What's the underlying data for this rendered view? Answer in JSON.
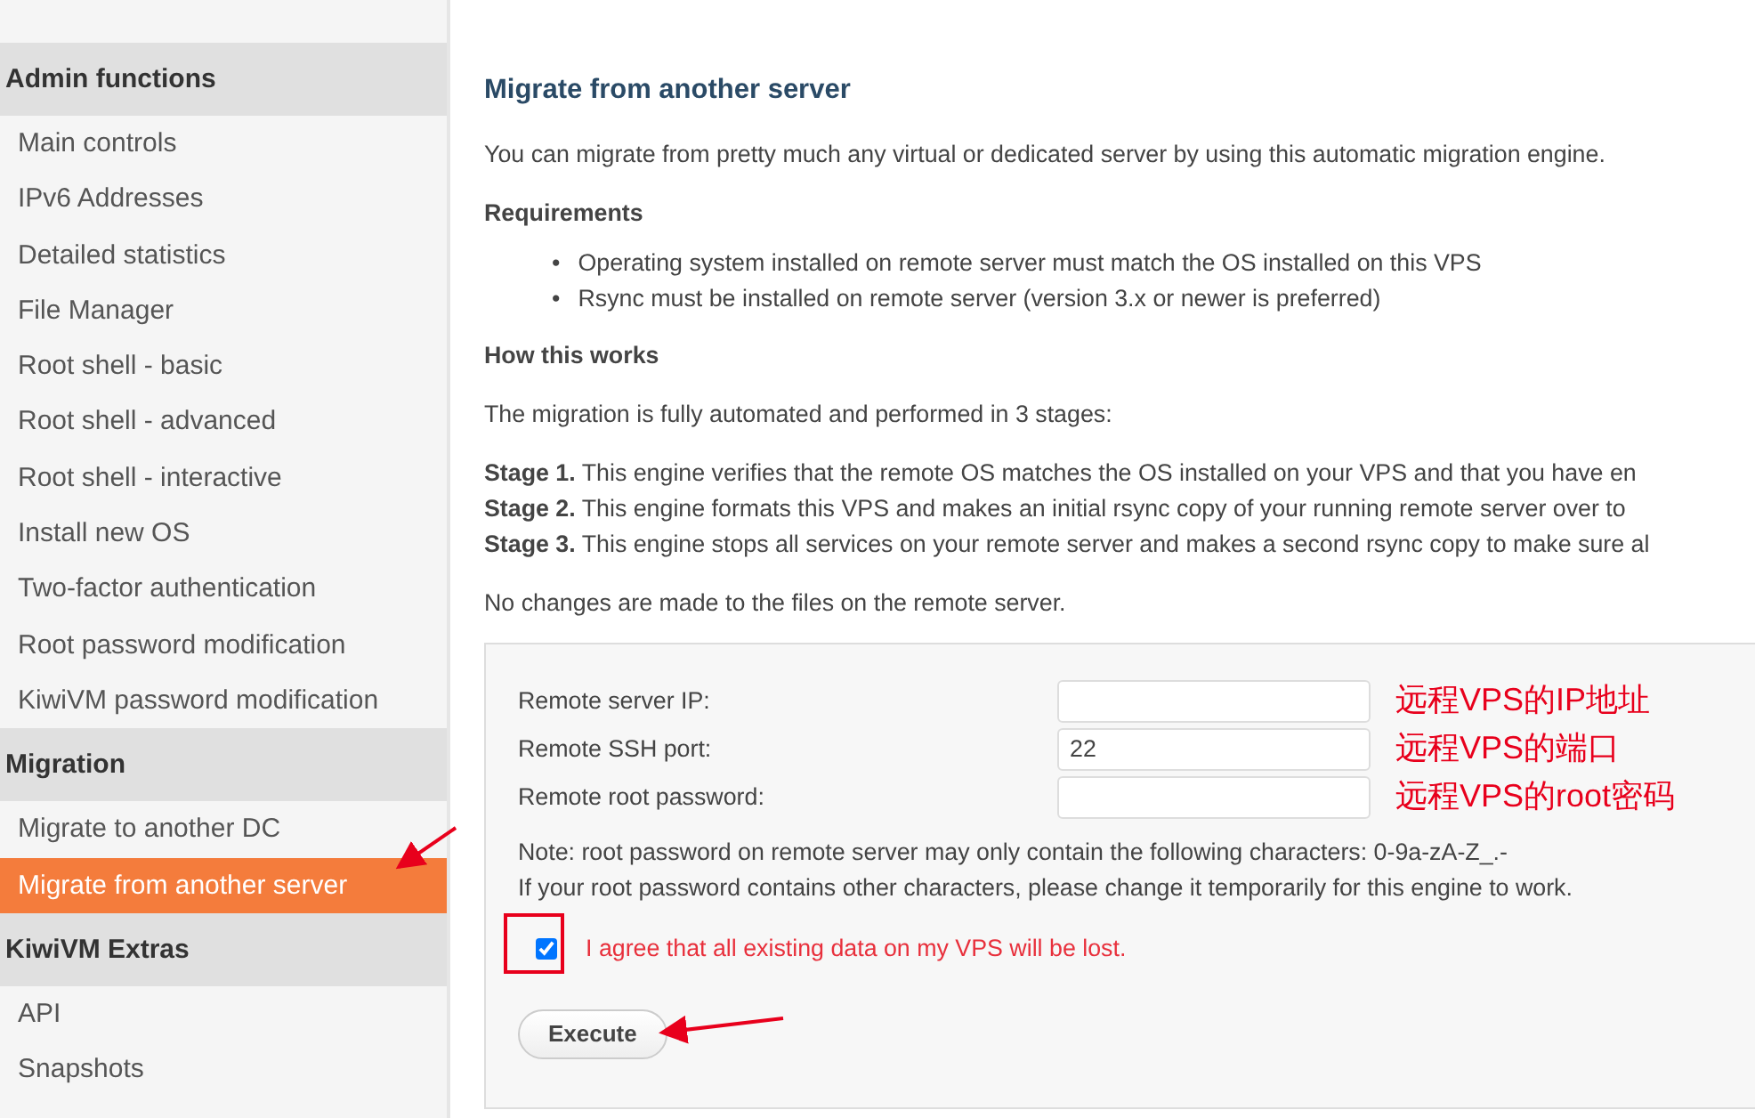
{
  "sidebar": {
    "sections": [
      {
        "title": "Admin functions",
        "items": [
          {
            "label": "Main controls",
            "selected": false
          },
          {
            "label": "IPv6 Addresses",
            "selected": false
          },
          {
            "label": "Detailed statistics",
            "selected": false
          },
          {
            "label": "File Manager",
            "selected": false
          },
          {
            "label": "Root shell - basic",
            "selected": false
          },
          {
            "label": "Root shell - advanced",
            "selected": false
          },
          {
            "label": "Root shell - interactive",
            "selected": false
          },
          {
            "label": "Install new OS",
            "selected": false
          },
          {
            "label": "Two-factor authentication",
            "selected": false
          },
          {
            "label": "Root password modification",
            "selected": false
          },
          {
            "label": "KiwiVM password modification",
            "selected": false
          }
        ]
      },
      {
        "title": "Migration",
        "items": [
          {
            "label": "Migrate to another DC",
            "selected": false
          },
          {
            "label": "Migrate from another server",
            "selected": true
          }
        ]
      },
      {
        "title": "KiwiVM Extras",
        "items": [
          {
            "label": "API",
            "selected": false
          },
          {
            "label": "Snapshots",
            "selected": false
          }
        ]
      }
    ]
  },
  "main": {
    "title": "Migrate from another server",
    "intro": "You can migrate from pretty much any virtual or dedicated server by using this automatic migration engine.",
    "requirements_title": "Requirements",
    "requirements": [
      {
        "marker": "•",
        "text": "Operating system installed on remote server must match the OS installed on this VPS"
      },
      {
        "marker": "•",
        "text": "Rsync must be installed on remote server (version 3.x or newer is preferred)"
      }
    ],
    "how_title": "How this works",
    "how_intro": "The migration is fully automated and performed in 3 stages:",
    "stages": [
      "**Stage 1.** This engine verifies that the remote OS matches the OS installed on your VPS and that you have en",
      "**Stage 2.** This engine formats this VPS and makes an initial rsync copy of your running remote server over to",
      "**Stage 3.** This engine stops all services on your remote server and makes a second rsync copy to make sure al"
    ],
    "no_changes": "No changes are made to the files on the remote server.",
    "form": {
      "fields": [
        {
          "label": "Remote server IP:",
          "annotation": "远程VPS的IP地址"
        },
        {
          "label": "Remote SSH port:",
          "value": "22",
          "annotation": "远程VPS的端口"
        },
        {
          "label": "Remote root password:",
          "annotation": "远程VPS的root密码"
        }
      ],
      "notes": [
        "Note: root password on remote server may only contain the following characters: 0-9a-zA-Z_.-",
        "If your root password contains other characters, please change it temporarily for this engine to work."
      ],
      "agree": {
        "label": "I agree that all existing data on my VPS will be lost.",
        "checked": true
      },
      "button": "Execute"
    }
  }
}
